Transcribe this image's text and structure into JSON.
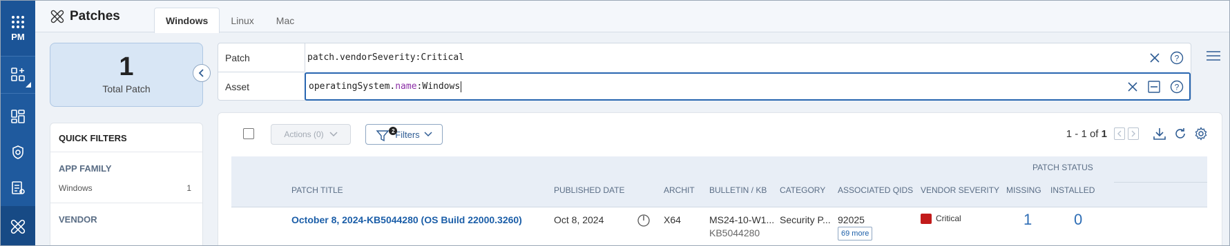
{
  "rail": {
    "app_label": "PM"
  },
  "header": {
    "title": "Patches",
    "tabs": [
      "Windows",
      "Linux",
      "Mac"
    ],
    "active_tab": "Windows"
  },
  "summary": {
    "count": "1",
    "label": "Total Patch"
  },
  "quick_filters": {
    "title": "QUICK FILTERS",
    "sections": [
      {
        "name": "APP FAMILY",
        "items": [
          {
            "label": "Windows",
            "count": "1"
          }
        ]
      },
      {
        "name": "VENDOR",
        "items": []
      }
    ]
  },
  "query": {
    "patch_label": "Patch",
    "patch_value": "patch.vendorSeverity:Critical",
    "asset_label": "Asset",
    "asset_prefix": "operatingSystem.",
    "asset_keyword": "name",
    "asset_suffix": ":Windows"
  },
  "toolbar": {
    "actions_label": "Actions (0)",
    "filters_label": "Filters",
    "filters_count": "2",
    "pager_range": "1 - 1 of",
    "pager_total": "1"
  },
  "table": {
    "group_header": "PATCH STATUS",
    "columns": [
      "PATCH TITLE",
      "PUBLISHED DATE",
      "ARCHIT",
      "BULLETIN / KB",
      "CATEGORY",
      "ASSOCIATED QIDS",
      "VENDOR SEVERITY",
      "MISSING",
      "INSTALLED"
    ],
    "rows": [
      {
        "title": "October 8, 2024-KB5044280 (OS Build 22000.3260)",
        "published": "Oct 8, 2024",
        "arch": "X64",
        "bulletin": "MS24-10-W1...",
        "kb": "KB5044280",
        "category": "Security P...",
        "qid": "92025",
        "more_qids": "69 more",
        "severity": "Critical",
        "missing": "1",
        "installed": "0"
      }
    ]
  },
  "colors": {
    "rail": "#1f5a9e",
    "accent": "#1b5ea8",
    "critical": "#c21b1b"
  }
}
